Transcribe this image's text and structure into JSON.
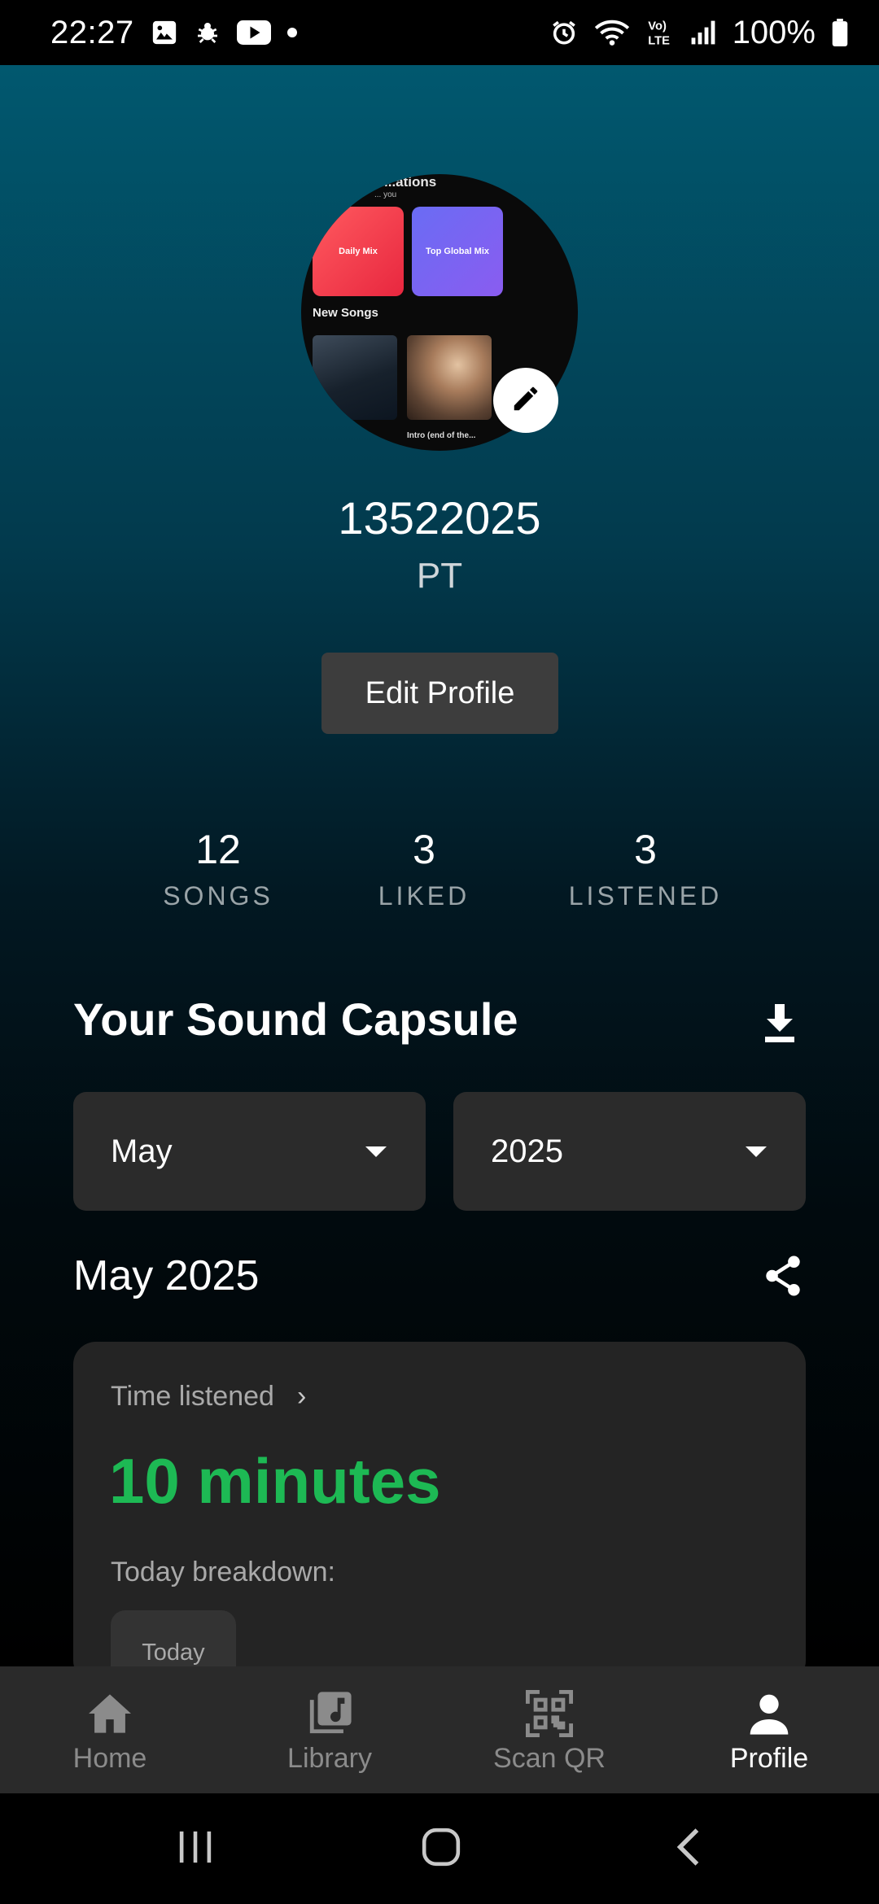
{
  "status_bar": {
    "time": "22:27",
    "battery": "100%",
    "lte_label": "Vo) LTE",
    "icons": [
      "gallery-icon",
      "bug-icon",
      "youtube-icon",
      "dot-icon",
      "alarm-icon",
      "wifi-icon",
      "lte-icon",
      "signal-icon",
      "battery-icon"
    ]
  },
  "avatar": {
    "title": "...ations",
    "subtitle": "... you",
    "card1": "Daily Mix",
    "card2": "Top Global Mix",
    "section": "New Songs",
    "caption1": "...",
    "caption2": "Intro (end of the...",
    "edit_icon": "pencil-icon"
  },
  "profile": {
    "username": "13522025",
    "fullname": "PT",
    "edit_button": "Edit Profile"
  },
  "stats": [
    {
      "value": "12",
      "label": "SONGS"
    },
    {
      "value": "3",
      "label": "LIKED"
    },
    {
      "value": "3",
      "label": "LISTENED"
    }
  ],
  "capsule": {
    "title": "Your Sound Capsule",
    "download_icon": "download-icon",
    "month": "May",
    "year": "2025",
    "period_title": "May 2025",
    "share_icon": "share-icon",
    "card": {
      "label": "Time listened",
      "chevron": "›",
      "value": "10 minutes",
      "breakdown": "Today breakdown:",
      "chip": "Today"
    }
  },
  "bottom_nav": [
    {
      "label": "Home",
      "icon": "home-icon",
      "active": false
    },
    {
      "label": "Library",
      "icon": "library-icon",
      "active": false
    },
    {
      "label": "Scan QR",
      "icon": "qr-icon",
      "active": false
    },
    {
      "label": "Profile",
      "icon": "profile-icon",
      "active": true
    }
  ],
  "colors": {
    "accent_green": "#1db954",
    "gradient_top": "#01586f",
    "card_bg": "#242424",
    "nav_bg": "#2a2a2a"
  }
}
